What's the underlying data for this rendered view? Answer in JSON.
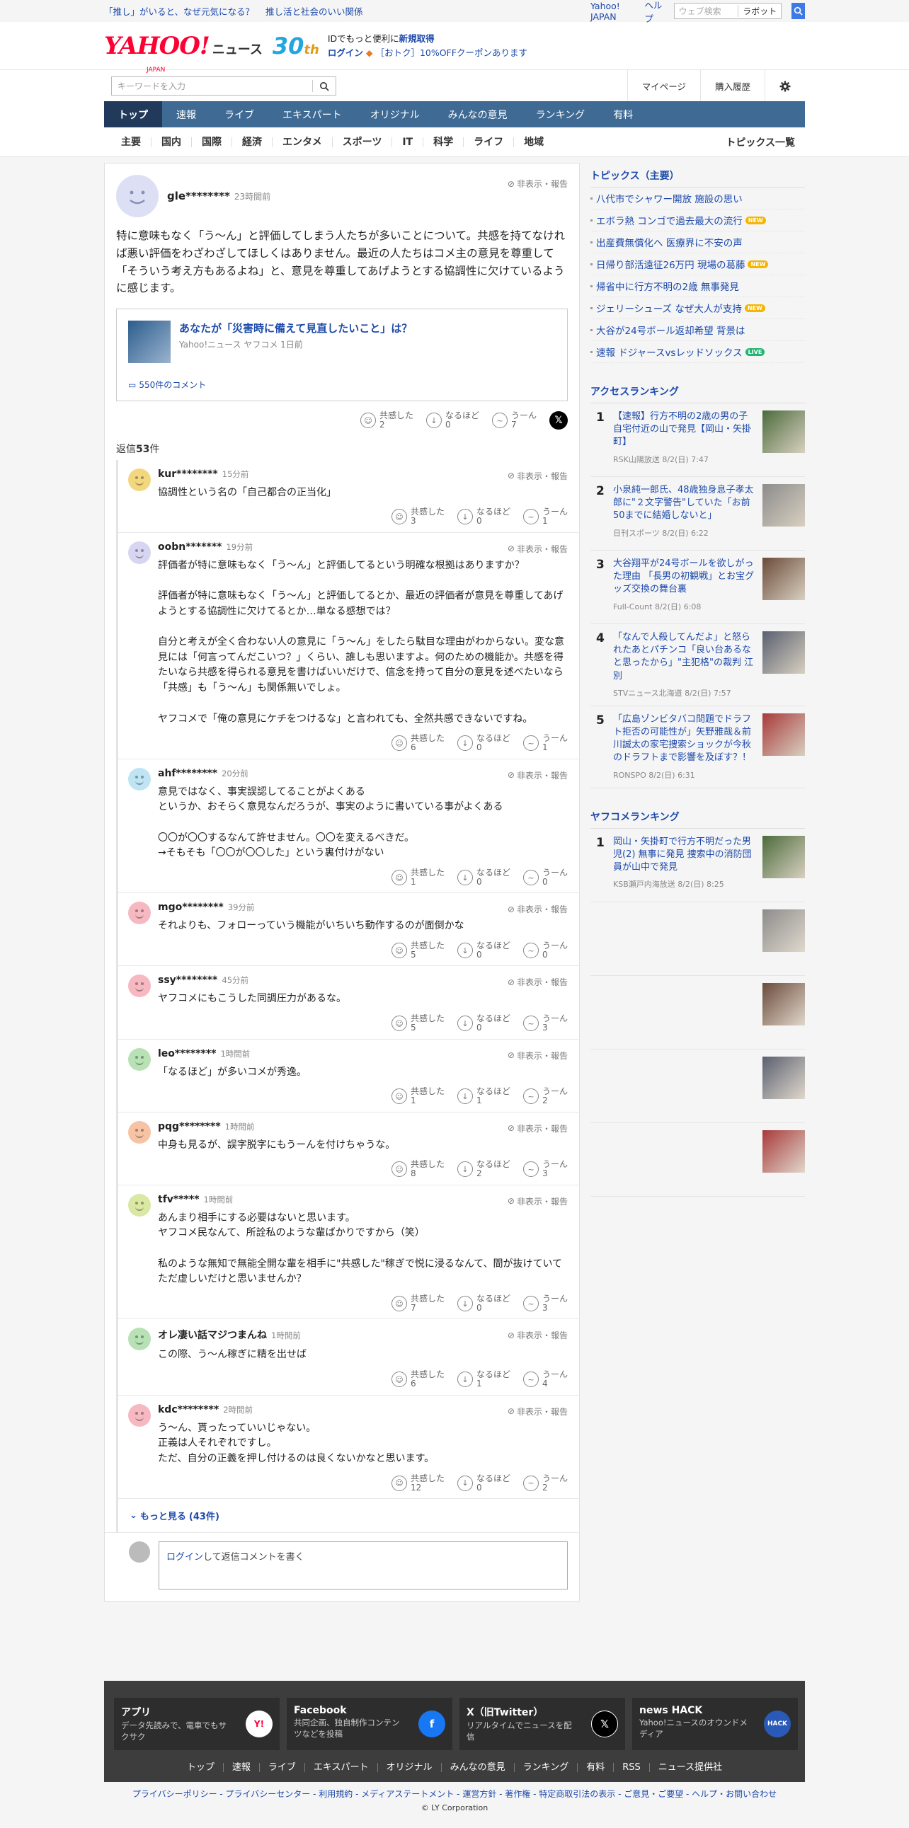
{
  "promo": {
    "link1": "「推し」がいると、なぜ元気になる？",
    "link2": "推し活と社会のいい関係"
  },
  "topbar": {
    "yahoo_japan": "Yahoo! JAPAN",
    "help": "ヘルプ",
    "web_search_placeholder": "ウェブ検索",
    "rabot_label": "ラボット"
  },
  "header": {
    "logo": "YAHOO!",
    "logo_sub": "JAPAN",
    "news_label": "ニュース",
    "badge": "30",
    "badge_suffix": "th",
    "id_text_prefix": "IDでもっと便利に",
    "register": "新規取得",
    "login": "ログイン",
    "coupon": "［おトク］10%OFFクーポンあります"
  },
  "search": {
    "placeholder": "キーワードを入力",
    "mypage": "マイページ",
    "history": "購入履歴"
  },
  "nav": {
    "tabs": [
      "トップ",
      "速報",
      "ライブ",
      "エキスパート",
      "オリジナル",
      "みんなの意見",
      "ランキング",
      "有料"
    ]
  },
  "subnav": {
    "cats": [
      "主要",
      "国内",
      "国際",
      "経済",
      "エンタメ",
      "スポーツ",
      "IT",
      "科学",
      "ライフ",
      "地域"
    ],
    "all_topics": "トピックス一覧"
  },
  "parent": {
    "user": "gle********",
    "time": "23時間前",
    "report": "非表示・報告",
    "text": "特に意味もなく「う〜ん」と評価してしまう人たちが多いことについて。共感を持てなければ悪い評価をわざわざしてほしくはありません。最近の人たちはコメ主の意見を尊重して「そういう考え方もあるよね」と、意見を尊重してあげようとする協調性に欠けているように感じます。",
    "card_title": "あなたが「災害時に備えて見直したいこと」は？",
    "card_source": "Yahoo!ニュース ヤフコメ 1日前",
    "card_comments": "550件のコメント",
    "react_labels": [
      "共感した",
      "なるほど",
      "うーん"
    ],
    "react_counts": [
      "2",
      "0",
      "7"
    ],
    "x_label": "𝕏"
  },
  "replies_header": {
    "prefix": "返信",
    "count": "53",
    "suffix": "件"
  },
  "replies": [
    {
      "user": "kur********",
      "time": "15分前",
      "text": "協調性という名の「自己都合の正当化」",
      "counts": [
        "3",
        "0",
        "1"
      ],
      "color": "#f3d77f"
    },
    {
      "user": "oobn*******",
      "time": "19分前",
      "text": "評価者が特に意味もなく「う〜ん」と評価してるという明確な根拠はありますか？\n\n評価者が特に意味もなく「う〜ん」と評価してるとか、最近の評価者が意見を尊重してあげようとする協調性に欠けてるとか…単なる感想では？\n\n自分と考えが全く合わない人の意見に「う〜ん」をしたら駄目な理由がわからない。変な意見には「何言ってんだこいつ？」くらい、誰しも思いますよ。何のための機能か。共感を得たいなら共感を得られる意見を書けばいいだけで、信念を持って自分の意見を述べたいなら「共感」も「う〜ん」も関係無いでしょ。\n\nヤフコメで「俺の意見にケチをつけるな」と言われても、全然共感できないですね。",
      "counts": [
        "6",
        "0",
        "1"
      ],
      "color": "#d6d6f2"
    },
    {
      "user": "ahf********",
      "time": "20分前",
      "text": "意見ではなく、事実誤認してることがよくある\nというか、おそらく意見なんだろうが、事実のように書いている事がよくある\n\n〇〇が〇〇するなんて許せません。〇〇を変えるべきだ。\n→そもそも「〇〇が〇〇した」という裏付けがない",
      "counts": [
        "1",
        "0",
        "0"
      ],
      "color": "#bfe4f4"
    },
    {
      "user": "mgo********",
      "time": "39分前",
      "text": "それよりも、フォローっていう機能がいちいち動作するのが面倒かな",
      "counts": [
        "5",
        "0",
        "0"
      ],
      "color": "#f6b9c1"
    },
    {
      "user": "ssy********",
      "time": "45分前",
      "text": "ヤフコメにもこうした同調圧力があるな。",
      "counts": [
        "5",
        "0",
        "3"
      ],
      "color": "#f6b9c1"
    },
    {
      "user": "leo********",
      "time": "1時間前",
      "text": "「なるほど」が多いコメが秀逸。",
      "counts": [
        "1",
        "1",
        "2"
      ],
      "color": "#b8e2b5"
    },
    {
      "user": "pqg********",
      "time": "1時間前",
      "text": "中身も見るが、誤字脱字にもうーんを付けちゃうな。",
      "counts": [
        "8",
        "2",
        "3"
      ],
      "color": "#f6c4a4"
    },
    {
      "user": "tfv*****",
      "time": "1時間前",
      "text": "あんまり相手にする必要はないと思います。\nヤフコメ民なんて、所詮私のような輩ばかりですから（笑）\n\n私のような無知で無能全開な輩を相手に\"共感した\"稼ぎで悦に浸るなんて、間が抜けていてただ虚しいだけと思いませんか？",
      "counts": [
        "7",
        "0",
        "3"
      ],
      "color": "#d9e8a3"
    },
    {
      "user": "オレ凄い話マジつまんね",
      "time": "1時間前",
      "text": "この際、う〜ん稼ぎに精を出せば",
      "counts": [
        "6",
        "1",
        "4"
      ],
      "color": "#b8e2b5"
    },
    {
      "user": "kdc********",
      "time": "2時間前",
      "text": "う〜ん、貰ったっていいじゃない。\n正義は人それぞれですし。\nただ、自分の正義を押し付けるのは良くないかなと思います。",
      "counts": [
        "12",
        "0",
        "2"
      ],
      "color": "#f6b9c1"
    }
  ],
  "more": {
    "label": "もっと見る",
    "count": "(43件)"
  },
  "login_box": {
    "link": "ログイン",
    "rest": "して返信コメントを書く"
  },
  "sidebar": {
    "topics_title": "トピックス（主要）",
    "topics": [
      {
        "text": "八代市でシャワー開放 施設の思い",
        "badge": ""
      },
      {
        "text": "エボラ熱 コンゴで過去最大の流行",
        "badge": "NEW"
      },
      {
        "text": "出産費無償化へ 医療界に不安の声",
        "badge": ""
      },
      {
        "text": "日帰り部活遠征26万円 現場の葛藤",
        "badge": "NEW"
      },
      {
        "text": "帰省中に行方不明の2歳 無事発見",
        "badge": ""
      },
      {
        "text": "ジェリーシューズ なぜ大人が支持",
        "badge": "NEW"
      },
      {
        "text": "大谷が24号ボール返却希望 背景は",
        "badge": ""
      },
      {
        "text": "速報 ドジャースvsレッドソックス",
        "badge": "LIVE"
      }
    ],
    "access_title": "アクセスランキング",
    "access": [
      {
        "n": "1",
        "title": "【速報】行方不明の2歳の男の子 自宅付近の山で発見【岡山・矢掛町】",
        "src": "RSK山陽放送 8/2(日) 7:47"
      },
      {
        "n": "2",
        "title": "小泉純一郎氏、48歳独身息子孝太郎に\"２文字警告\"していた「お前50までに結婚しないと」",
        "src": "日刊スポーツ 8/2(日) 6:22"
      },
      {
        "n": "3",
        "title": "大谷翔平が24号ボールを欲しがった理由 「長男の初観戦」とお宝グッズ交換の舞台裏",
        "src": "Full-Count 8/2(日) 6:08"
      },
      {
        "n": "4",
        "title": "「なんで人殺してんだよ」と怒られたあとパチンコ「良い台あるなと思ったから」\"主犯格\"の裁判 江別",
        "src": "STVニュース北海道 8/2(日) 7:57"
      },
      {
        "n": "5",
        "title": "「広島ゾンビタバコ問題でドラフト拒否の可能性が」矢野雅哉＆前川誠太の家宅捜索ショックが今秋のドラフトまで影響を及ぼす？！",
        "src": "RONSPO 8/2(日) 6:31"
      }
    ],
    "yafucome_title": "ヤフコメランキング",
    "yafucome": [
      {
        "n": "1",
        "title": "岡山・矢掛町で行方不明だった男児(2) 無事に発見 捜索中の消防団員が山中で発見",
        "src": "KSB瀬戸内海放送 8/2(日) 8:25"
      }
    ]
  },
  "footer": {
    "cards": [
      {
        "title": "アプリ",
        "desc": "データ先読みで、電車でもサクサク",
        "icon": "Y!"
      },
      {
        "title": "Facebook",
        "desc": "共同企画、独自制作コンテンツなどを投稿",
        "icon": "f"
      },
      {
        "title": "X（旧Twitter）",
        "desc": "リアルタイムでニュースを配信",
        "icon": "𝕏"
      },
      {
        "title": "news HACK",
        "desc": "Yahoo!ニュースのオウンドメディア",
        "icon": "HACK"
      }
    ],
    "links": [
      "トップ",
      "速報",
      "ライブ",
      "エキスパート",
      "オリジナル",
      "みんなの意見",
      "ランキング",
      "有料",
      "RSS",
      "ニュース提供社"
    ],
    "legal": "プライバシーポリシー - プライバシーセンター - 利用規約 - メディアステートメント - 運営方針 - 著作権 - 特定商取引法の表示 - ご意見・ご要望 - ヘルプ・お問い合わせ",
    "copyright": "© LY Corporation"
  },
  "colors": {
    "nav": "#3e6a94",
    "nav_active": "#21395a",
    "link": "#1d4aab",
    "brand": "#ff0033"
  }
}
